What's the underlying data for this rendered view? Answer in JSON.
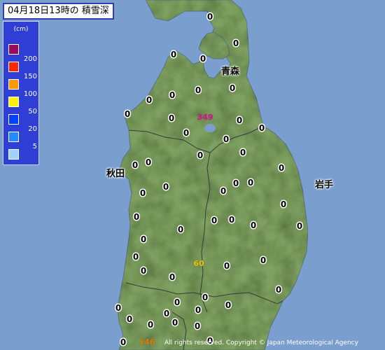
{
  "title": "04月18日13時の 積雪深",
  "legend": {
    "unit": "(cm)",
    "items": [
      {
        "color": "#9c0a5e",
        "label": ""
      },
      {
        "color": "#ff2800",
        "label": "200"
      },
      {
        "color": "#ff9900",
        "label": "150"
      },
      {
        "color": "#fff000",
        "label": "100"
      },
      {
        "color": "#0041ff",
        "label": "50"
      },
      {
        "color": "#218cff",
        "label": "20"
      },
      {
        "color": "#a0d2ff",
        "label": "5"
      }
    ]
  },
  "prefectures": [
    "青森",
    "秋田",
    "岩手"
  ],
  "special_values": [
    {
      "value": "349",
      "color": "#d8148c"
    },
    {
      "value": "60",
      "color": "#e8c400"
    },
    {
      "value": "146",
      "color": "#e07a00"
    }
  ],
  "zero_label": "0",
  "copyright": "All rights reserved. Copyright © Japan Meteorological Agency",
  "colors": {
    "sea": "#7a9fcf",
    "land": "#7ea060",
    "border": "#3a3a3a"
  }
}
